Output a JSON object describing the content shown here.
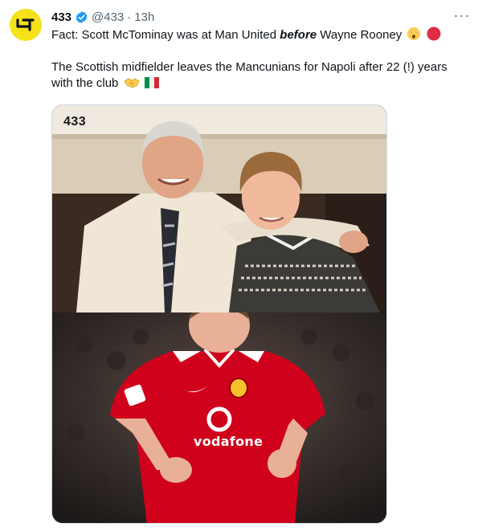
{
  "author": {
    "name": "433",
    "handle": "@433",
    "separator": "·",
    "time": "13h",
    "avatar_icon": "433-logo-icon",
    "verified_icon": "verified-badge-icon"
  },
  "more_icon": "more-options-icon",
  "more_label": "···",
  "tweet": {
    "line1_prefix": "Fact: Scott McTominay was at Man United ",
    "line1_emphasis": "before",
    "line1_suffix": " Wayne Rooney",
    "line1_emojis": [
      "astonished-face-emoji",
      "red-circle-emoji"
    ],
    "line2": "The Scottish midfielder leaves the Mancunians for Napoli after 22 (!) years",
    "line3": "with the club",
    "line3_emojis": [
      "handshake-emoji",
      "italy-flag-emoji"
    ]
  },
  "media": {
    "watermark": "433",
    "shirt_sponsor": "vodafone",
    "accent_color": "#d0021b"
  },
  "colors": {
    "verified": "#1d9bf0",
    "avatar_bg": "#f4e21b",
    "secondary_text": "#536471"
  }
}
